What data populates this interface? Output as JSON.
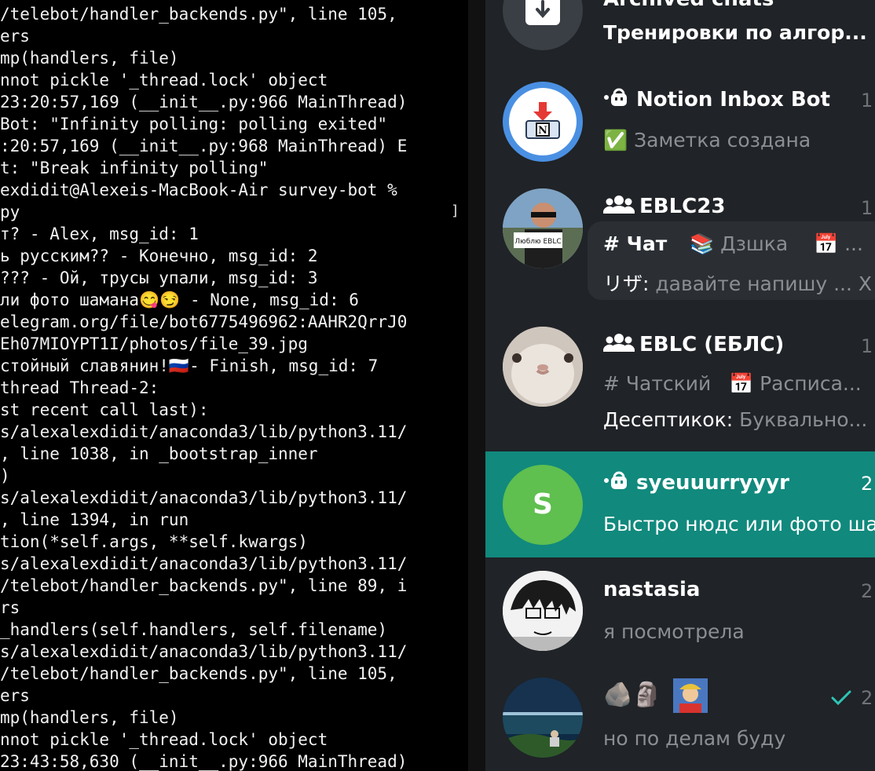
{
  "terminal": {
    "lines": [
      "/telebot/handler_backends.py\", line 105,",
      "ers",
      "mp(handlers, file)",
      "nnot pickle '_thread.lock' object",
      "23:20:57,169 (__init__.py:966 MainThread)",
      "Bot: \"Infinity polling: polling exited\"",
      ":20:57,169 (__init__.py:968 MainThread) E",
      "t: \"Break infinity polling\"",
      "exdidit@Alexeis-MacBook-Air survey-bot %",
      "py",
      "т? - Alex, msg_id: 1",
      "ь русским?? - Конечно, msg_id: 2",
      "??? - Ой, трусы упали, msg_id: 3",
      "ли фото шамана😋😏 - None, msg_id: 6",
      "elegram.org/file/bot6775496962:AAHR2QrrJ0",
      "Eh07MIOYPT1I/photos/file_39.jpg",
      "стойный славянин!🇷🇺- Finish, msg_id: 7",
      "thread Thread-2:",
      "st recent call last):",
      "s/alexalexdidit/anaconda3/lib/python3.11/",
      ", line 1038, in _bootstrap_inner",
      ")",
      "s/alexalexdidit/anaconda3/lib/python3.11/",
      ", line 1394, in run",
      "tion(*self.args, **self.kwargs)",
      "s/alexalexdidit/anaconda3/lib/python3.11/",
      "/telebot/handler_backends.py\", line 89, i",
      "rs",
      "_handlers(self.handlers, self.filename)",
      "s/alexalexdidit/anaconda3/lib/python3.11/",
      "/telebot/handler_backends.py\", line 105,",
      "ers",
      "mp(handlers, file)",
      "nnot pickle '_thread.lock' object",
      "23:43:58,630 (__init__.py:966 MainThread)"
    ],
    "bracket": "]"
  },
  "chats": {
    "archived": {
      "title": "Archived chats",
      "preview": "Тренировки по алгор..."
    },
    "items": [
      {
        "name": "Notion Inbox Bot",
        "time": "1",
        "preview": "Заметка создана",
        "preview_emoji": "✅"
      },
      {
        "name": "EBLC23",
        "time": "1",
        "avatar_caption": "Люблю EBLC",
        "tabs": [
          "# Чат",
          "Дзшка",
          "..."
        ],
        "tab_emojis": [
          "📚",
          "📅"
        ],
        "sender": "リザ:",
        "preview": "давайте напишу ...",
        "preview_tail": "X"
      },
      {
        "name": "EBLC (ЕБЛС)",
        "time": "1",
        "tabs": [
          "# Чатский",
          "Расписа..."
        ],
        "tab_emojis": [
          "📅"
        ],
        "sender": "Десептикок:",
        "preview": "Буквально..."
      },
      {
        "name": "syeuuurryyyr",
        "time": "2",
        "avatar_letter": "S",
        "preview": "Быстро нюдс или фото ша"
      },
      {
        "name": "nastasia",
        "time": "2",
        "preview": "я посмотрела"
      },
      {
        "name": "",
        "time": "2",
        "title_emojis": [
          "🪨",
          "🗿"
        ],
        "preview": "но по делам буду"
      }
    ]
  },
  "colors": {
    "terminal_bg": "#000000",
    "chat_list_bg": "#202327",
    "active_row": "#11897d",
    "check": "#2ec4b6"
  },
  "icons": [
    "archive-icon",
    "bot-icon",
    "group-icon",
    "checkmark-icon"
  ]
}
